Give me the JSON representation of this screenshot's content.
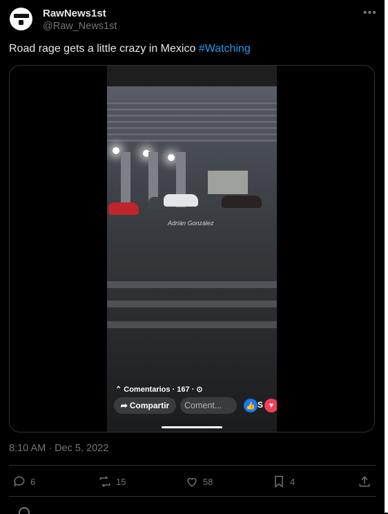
{
  "author": {
    "name": "RawNews1st",
    "handle": "@Raw_News1st"
  },
  "menu_icon": "more-horizontal-icon",
  "tweet": {
    "text": "Road rage gets a little crazy in Mexico ",
    "hashtag": "#Watching"
  },
  "video": {
    "watermark": "Adrián González",
    "comments_line": "⌃ Comentarios · 167 · ⊙",
    "share_label": "Compartir",
    "comment_placeholder": "Coment...",
    "reaction_suffix": "S"
  },
  "timestamp": "8:10 AM · Dec 5, 2022",
  "actions": {
    "replies": "6",
    "reposts": "15",
    "likes": "58",
    "bookmarks": "4"
  },
  "colors": {
    "background": "#000000",
    "text": "#e7e9ea",
    "muted": "#71767b",
    "link": "#1d9bf0",
    "border": "#2f3336"
  }
}
